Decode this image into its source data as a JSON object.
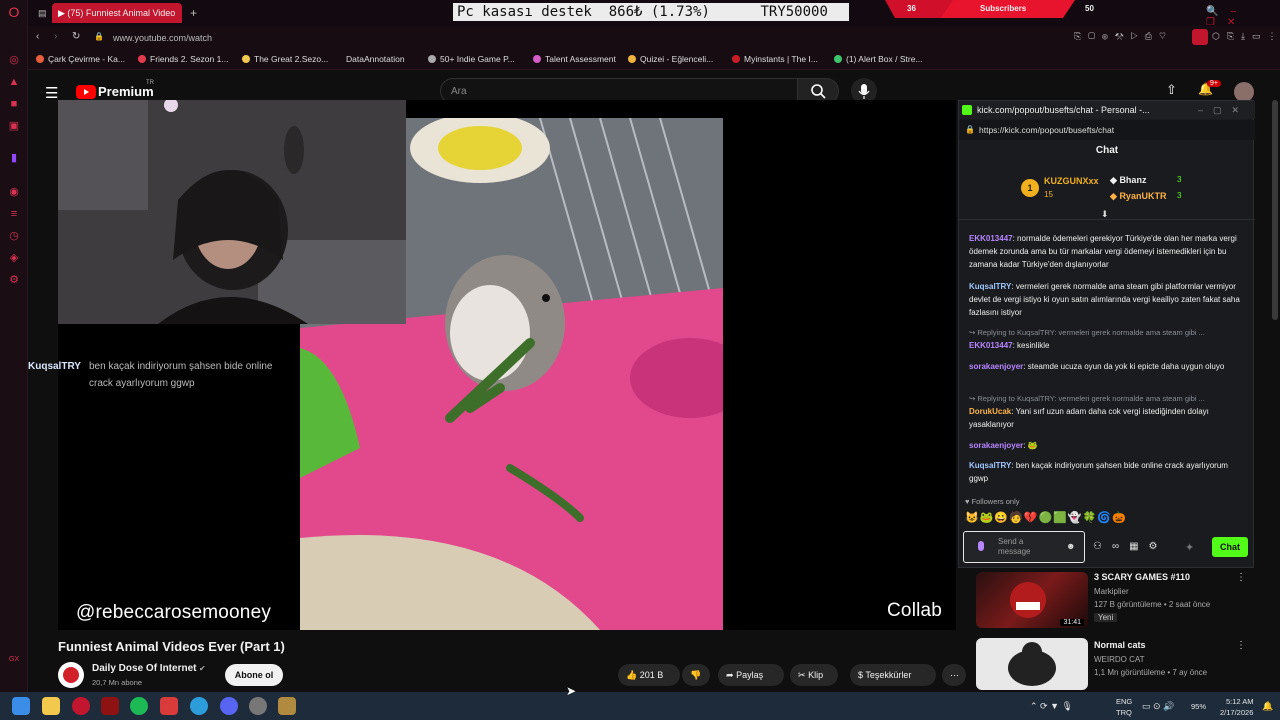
{
  "browser": {
    "tabs": [
      {
        "label": "(75) Funniest Animal Video"
      }
    ],
    "url": "www.youtube.com/watch",
    "bookmarks": [
      "Çark Çevirme - Ka...",
      "Friends 2. Sezon 1...",
      "The Great 2.Sezo...",
      "DataAnnotation",
      "50+ Indie Game P...",
      "Talent Assessment",
      "Quizei - Eğlenceli...",
      "Myinstants | The I...",
      "(1) Alert Box / Stre..."
    ]
  },
  "overlay": {
    "banner_left": "Pc kasası destek",
    "banner_amount": "866₺",
    "banner_percent": "(1.73%)",
    "banner_goal": "TRY50000",
    "subs_left": "36",
    "subs_label": "Subscribers",
    "subs_right": "50"
  },
  "youtube": {
    "logo": "Premium",
    "logo_badge": "TR",
    "search_placeholder": "Ara",
    "notif_count": "9+",
    "video_caption_left": "@rebeccarosemooney",
    "video_caption_right": "Collab",
    "title": "Funniest Animal Videos Ever (Part 1)",
    "channel": "Daily Dose Of Internet",
    "subs": "20,7 Mn abone",
    "subscribe": "Abone ol",
    "likes": "201 B",
    "share": "Paylaş",
    "clip": "Klip",
    "thanks": "Teşekkürler",
    "chat_overlay_user": "KuqsalTRY",
    "chat_overlay_line1": "ben kaçak indiriyorum şahsen bide online",
    "chat_overlay_line2": "crack ayarlıyorum ggwp",
    "recommendations": [
      {
        "title": "3 SCARY GAMES #110",
        "channel": "Markiplier",
        "meta": "127 B görüntüleme • 2 saat önce",
        "badge": "Yeni",
        "duration": "31:41"
      },
      {
        "title": "Normal cats",
        "channel": "WEIRDO CAT",
        "meta": "1,1 Mn görüntüleme • 7 ay önce"
      }
    ]
  },
  "kick": {
    "window_title": "kick.com/popout/busefts/chat - Personal -...",
    "url": "https://kick.com/popout/busefts/chat",
    "header": "Chat",
    "leader_top": {
      "name": "KUZGUNXxx",
      "count": "15",
      "rank": "1"
    },
    "leader_2": {
      "name": "Bhanz",
      "count": "3"
    },
    "leader_3": {
      "name": "RyanUKTR",
      "count": "3"
    },
    "messages": [
      {
        "user": "EKK013447",
        "text": "normalde ödemeleri gerekiyor Türkiye'de olan her marka vergi ödemek zorunda ama bu tür markalar vergi ödemeyi istemedikleri için bu zamana kadar Türkiye'den dışlanıyorlar"
      },
      {
        "user": "KuqsalTRY",
        "text": "vermeleri gerek normalde ama steam gibi platformlar vermiyor devlet de vergi istiyo ki oyun satın alımlarında vergi keailiyo zaten fakat saha fazlasını istiyor"
      },
      {
        "reply": "Replying to KuqsalTRY: vermeleri gerek normalde ama steam gibi ..."
      },
      {
        "user": "EKK013447",
        "text": "kesinlikle"
      },
      {
        "user": "sorakaenjoyer",
        "text": "steamde ucuza oyun da yok ki epicte daha uygun oluyo"
      },
      {
        "reply": "Replying to KuqsalTRY: vermeleri gerek normalde ama steam gibi ..."
      },
      {
        "user": "DorukUcak",
        "text": "Yani sırf uzun adam daha cok vergi istediğinden dolayı yasaklanıyor"
      },
      {
        "user": "sorakaenjoyer",
        "text": ""
      },
      {
        "user": "KuqsalTRY",
        "text": "ben kaçak indiriyorum şahsen bide online crack ayarlıyorum ggwp"
      }
    ],
    "followers_only": "Followers only",
    "send_placeholder": "Send a message",
    "chat_button": "Chat"
  },
  "taskbar": {
    "lang1": "ENG",
    "lang2": "TRQ",
    "battery": "95%",
    "time": "5:12 AM",
    "date": "2/17/2026"
  },
  "colors": {
    "brand_red": "#c2162f",
    "kick_green": "#53fc18",
    "user_purple": "#b785ff",
    "user_blue": "#9fc8ff",
    "user_orange": "#ffb347"
  }
}
